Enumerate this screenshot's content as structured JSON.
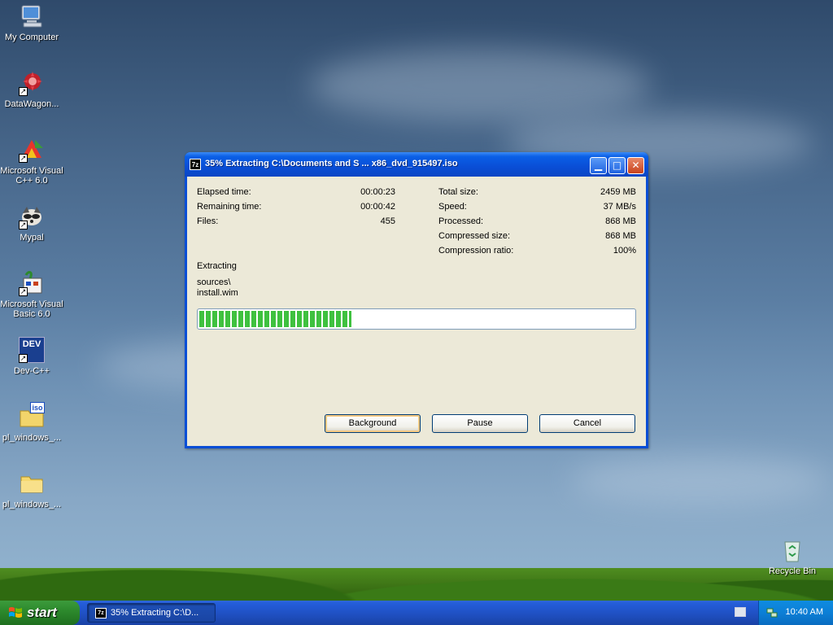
{
  "desktop": {
    "icons": [
      {
        "label": "My Computer"
      },
      {
        "label": "DataWagon..."
      },
      {
        "label": "Microsoft Visual C++ 6.0"
      },
      {
        "label": "Mypal"
      },
      {
        "label": "Microsoft Visual Basic 6.0"
      },
      {
        "label": "Dev-C++"
      },
      {
        "label": "pl_windows_..."
      },
      {
        "label": "pl_windows_..."
      },
      {
        "label": "Recycle Bin"
      }
    ],
    "iso_badge": "iso",
    "dev_badge": "DEV"
  },
  "dialog": {
    "icon_text": "7z",
    "title": "35% Extracting C:\\Documents and S ... x86_dvd_915497.iso",
    "left_stats": [
      {
        "label": "Elapsed time:",
        "value": "00:00:23"
      },
      {
        "label": "Remaining time:",
        "value": "00:00:42"
      },
      {
        "label": "Files:",
        "value": "455"
      }
    ],
    "right_stats": [
      {
        "label": "Total size:",
        "value": "2459 MB"
      },
      {
        "label": "Speed:",
        "value": "37 MB/s"
      },
      {
        "label": "Processed:",
        "value": "868 MB"
      },
      {
        "label": "Compressed size:",
        "value": "868 MB"
      },
      {
        "label": "Compression ratio:",
        "value": "100%"
      }
    ],
    "status_label": "Extracting",
    "current_path": "sources\\",
    "current_file": "install.wim",
    "progress_percent": 35,
    "buttons": {
      "background": "Background",
      "pause": "Pause",
      "cancel": "Cancel"
    }
  },
  "taskbar": {
    "start_label": "start",
    "task_icon_text": "7z",
    "task_item_label": "35% Extracting C:\\D...",
    "clock": "10:40 AM"
  },
  "colors": {
    "progress": "#3fc13f",
    "titlebar": "#0a4ed6",
    "start": "#2d8a2d"
  }
}
